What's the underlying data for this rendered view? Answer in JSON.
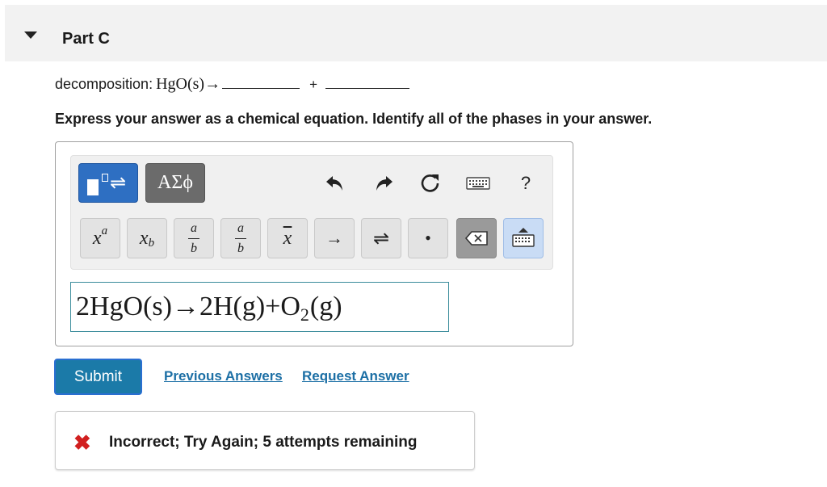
{
  "header": {
    "title": "Part C"
  },
  "question": {
    "label": "decomposition:",
    "reactant": "HgO(s)→",
    "plus": "+"
  },
  "instruction": "Express your answer as a chemical equation. Identify all of the phases in your answer.",
  "toolbar": {
    "greek_label": "ΑΣϕ",
    "help_label": "?",
    "keys": {
      "superscript_base": "x",
      "superscript_exp": "a",
      "subscript_base": "x",
      "subscript_sub": "b",
      "frac_num": "a",
      "frac_den": "b",
      "frac_small_num": "a",
      "frac_small_den": "b",
      "overline_x": "x",
      "arrow": "→",
      "equilibrium": "⇌",
      "dot": "•"
    }
  },
  "answer": {
    "part1": "2HgO(s)→2H(g)+O",
    "subscript": "2",
    "part2": "(g)"
  },
  "actions": {
    "submit": "Submit",
    "previous_answers": "Previous Answers",
    "request_answer": "Request Answer"
  },
  "feedback": {
    "message": "Incorrect; Try Again; 5 attempts remaining",
    "status_color": "#d11f1f"
  },
  "icons": [
    "caret-down-icon",
    "templates-icon",
    "undo-icon",
    "redo-icon",
    "reset-icon",
    "keyboard-icon",
    "help-icon",
    "delete-icon",
    "incorrect-x-icon"
  ]
}
